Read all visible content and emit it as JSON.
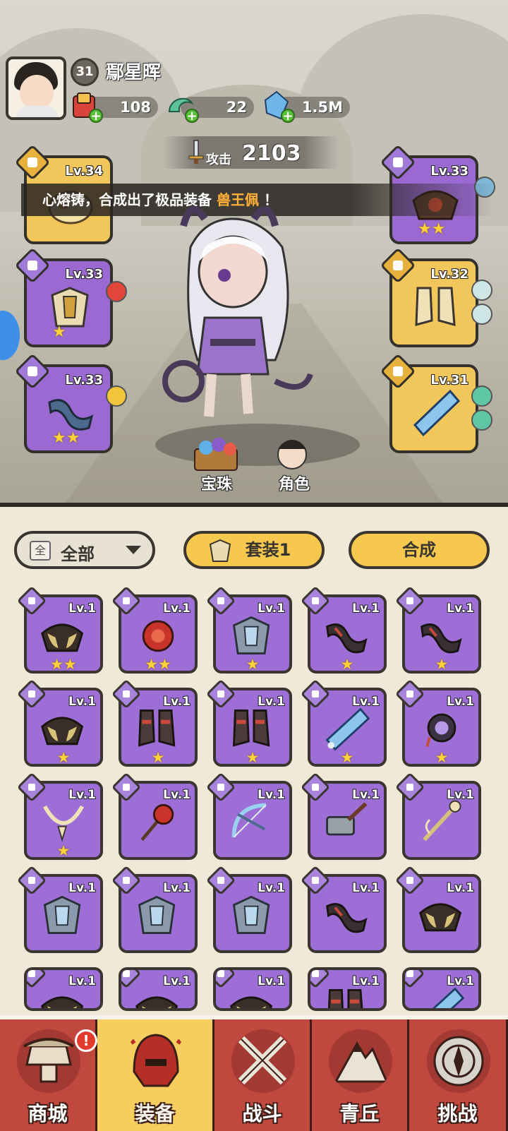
{
  "player": {
    "level": "31",
    "name": "鄢星晖",
    "resources": [
      {
        "icon": "ticket-bag-icon",
        "value": "108"
      },
      {
        "icon": "jade-dragon-icon",
        "value": "22"
      },
      {
        "icon": "crystal-icon",
        "value": "1.5M"
      }
    ],
    "attack_label": "攻击",
    "attack_value": "2103"
  },
  "banner": {
    "prefix": "心熔铸，合成出了极品装备",
    "highlight": "兽王佩",
    "suffix": "！"
  },
  "equipped": {
    "left": [
      {
        "level": "Lv.34",
        "stars": 0,
        "color": "gold",
        "icon": "sword-amulet-icon"
      },
      {
        "level": "Lv.33",
        "stars": 1,
        "color": "purple",
        "icon": "armor-icon"
      },
      {
        "level": "Lv.33",
        "stars": 2,
        "color": "purple",
        "icon": "bracer-icon"
      }
    ],
    "right": [
      {
        "level": "Lv.33",
        "stars": 2,
        "color": "purple",
        "icon": "shoulder-icon"
      },
      {
        "level": "Lv.32",
        "stars": 0,
        "color": "gold",
        "icon": "boots-icon"
      },
      {
        "level": "Lv.31",
        "stars": 0,
        "color": "gold",
        "icon": "pendant-icon"
      }
    ]
  },
  "scene_buttons": {
    "orbs": "宝珠",
    "character": "角色"
  },
  "filter": {
    "box": "全",
    "label": "全部"
  },
  "buttons": {
    "set": "套装1",
    "combine": "合成"
  },
  "inventory": [
    {
      "level": "Lv.1",
      "stars": 2,
      "icon": "shoulder-icon"
    },
    {
      "level": "Lv.1",
      "stars": 2,
      "icon": "orb-pendant-icon"
    },
    {
      "level": "Lv.1",
      "stars": 1,
      "icon": "armor-icon"
    },
    {
      "level": "Lv.1",
      "stars": 1,
      "icon": "bracer-icon"
    },
    {
      "level": "Lv.1",
      "stars": 1,
      "icon": "bracer-icon"
    },
    {
      "level": "Lv.1",
      "stars": 1,
      "icon": "shoulder-icon"
    },
    {
      "level": "Lv.1",
      "stars": 1,
      "icon": "boots-icon"
    },
    {
      "level": "Lv.1",
      "stars": 1,
      "icon": "boots-icon"
    },
    {
      "level": "Lv.1",
      "stars": 1,
      "icon": "pendant-icon"
    },
    {
      "level": "Lv.1",
      "stars": 1,
      "icon": "amulet-icon"
    },
    {
      "level": "Lv.1",
      "stars": 1,
      "icon": "necklace-icon"
    },
    {
      "level": "Lv.1",
      "stars": 0,
      "icon": "flower-staff-icon"
    },
    {
      "level": "Lv.1",
      "stars": 0,
      "icon": "bow-icon"
    },
    {
      "level": "Lv.1",
      "stars": 0,
      "icon": "hammer-icon"
    },
    {
      "level": "Lv.1",
      "stars": 0,
      "icon": "staff-icon"
    },
    {
      "level": "Lv.1",
      "stars": 0,
      "icon": "armor-icon"
    },
    {
      "level": "Lv.1",
      "stars": 0,
      "icon": "armor-icon"
    },
    {
      "level": "Lv.1",
      "stars": 0,
      "icon": "armor-icon"
    },
    {
      "level": "Lv.1",
      "stars": 0,
      "icon": "bracer-icon"
    },
    {
      "level": "Lv.1",
      "stars": 0,
      "icon": "shoulder-icon"
    },
    {
      "level": "Lv.1",
      "stars": 0,
      "icon": "shoulder-icon"
    },
    {
      "level": "Lv.1",
      "stars": 0,
      "icon": "shoulder-icon"
    },
    {
      "level": "Lv.1",
      "stars": 0,
      "icon": "shoulder-icon"
    },
    {
      "level": "Lv.1",
      "stars": 0,
      "icon": "boots-icon"
    },
    {
      "level": "Lv.1",
      "stars": 0,
      "icon": "pendant-icon"
    }
  ],
  "nav": [
    {
      "label": "商城",
      "icon": "shop-icon",
      "alert": "!"
    },
    {
      "label": "装备",
      "icon": "helmet-icon",
      "active": true
    },
    {
      "label": "战斗",
      "icon": "crossed-swords-icon"
    },
    {
      "label": "青丘",
      "icon": "mountain-icon"
    },
    {
      "label": "挑战",
      "icon": "compass-icon"
    }
  ],
  "colors": {
    "gold_slot": "#f1c65a",
    "purple_slot": "#9a6ad2",
    "nav_red": "#c0483f",
    "nav_active": "#f5ce5d",
    "banner_highlight": "#ffb237"
  }
}
